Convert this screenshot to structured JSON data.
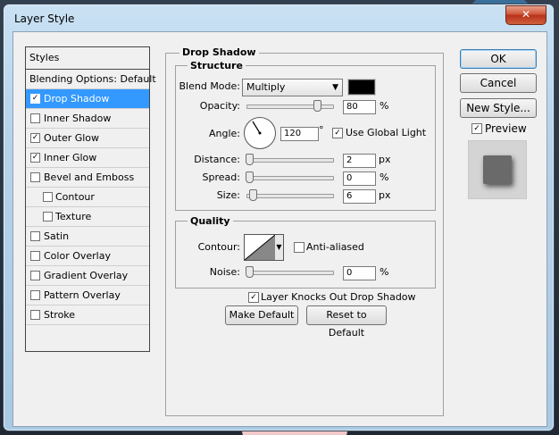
{
  "window": {
    "title": "Layer Style",
    "close_icon": "close-icon"
  },
  "styles_list": {
    "header": "Styles",
    "items": [
      {
        "label": "Blending Options: Default",
        "checkbox": false,
        "checked": false,
        "selected": false,
        "indent": 0
      },
      {
        "label": "Drop Shadow",
        "checkbox": true,
        "checked": true,
        "selected": true,
        "indent": 1
      },
      {
        "label": "Inner Shadow",
        "checkbox": true,
        "checked": false,
        "selected": false,
        "indent": 1
      },
      {
        "label": "Outer Glow",
        "checkbox": true,
        "checked": true,
        "selected": false,
        "indent": 1
      },
      {
        "label": "Inner Glow",
        "checkbox": true,
        "checked": true,
        "selected": false,
        "indent": 1
      },
      {
        "label": "Bevel and Emboss",
        "checkbox": true,
        "checked": false,
        "selected": false,
        "indent": 1
      },
      {
        "label": "Contour",
        "checkbox": true,
        "checked": false,
        "selected": false,
        "indent": 2
      },
      {
        "label": "Texture",
        "checkbox": true,
        "checked": false,
        "selected": false,
        "indent": 2
      },
      {
        "label": "Satin",
        "checkbox": true,
        "checked": false,
        "selected": false,
        "indent": 1
      },
      {
        "label": "Color Overlay",
        "checkbox": true,
        "checked": false,
        "selected": false,
        "indent": 1
      },
      {
        "label": "Gradient Overlay",
        "checkbox": true,
        "checked": false,
        "selected": false,
        "indent": 1
      },
      {
        "label": "Pattern Overlay",
        "checkbox": true,
        "checked": false,
        "selected": false,
        "indent": 1
      },
      {
        "label": "Stroke",
        "checkbox": true,
        "checked": false,
        "selected": false,
        "indent": 1
      }
    ]
  },
  "drop_shadow": {
    "title": "Drop Shadow",
    "structure": {
      "title": "Structure",
      "blend_mode_label": "Blend Mode:",
      "blend_mode_value": "Multiply",
      "shadow_color": "#000000",
      "opacity_label": "Opacity:",
      "opacity_value": "80",
      "opacity_unit": "%",
      "opacity_fraction": 0.8,
      "angle_label": "Angle:",
      "angle_value": "120",
      "angle_unit": "°",
      "use_global_light_label": "Use Global Light",
      "use_global_light_checked": true,
      "distance_label": "Distance:",
      "distance_value": "2",
      "distance_unit": "px",
      "spread_label": "Spread:",
      "spread_value": "0",
      "spread_unit": "%",
      "size_label": "Size:",
      "size_value": "6",
      "size_unit": "px"
    },
    "quality": {
      "title": "Quality",
      "contour_label": "Contour:",
      "anti_aliased_label": "Anti-aliased",
      "anti_aliased_checked": false,
      "noise_label": "Noise:",
      "noise_value": "0",
      "noise_unit": "%"
    },
    "knockout_label": "Layer Knocks Out Drop Shadow",
    "knockout_checked": true,
    "make_default_label": "Make Default",
    "reset_default_label": "Reset to Default"
  },
  "actions": {
    "ok_label": "OK",
    "cancel_label": "Cancel",
    "new_style_label": "New Style...",
    "preview_label": "Preview",
    "preview_checked": true
  },
  "colors": {
    "selection": "#3399ff",
    "dialog_bg": "#f0f0f0",
    "title_gradient": "#b7d3ea",
    "close_button": "#c8452a"
  }
}
